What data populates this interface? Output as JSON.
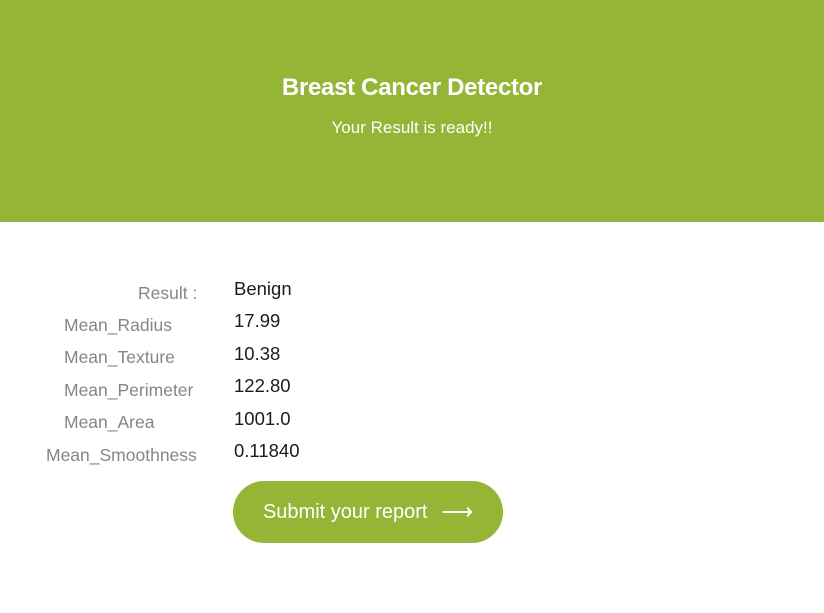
{
  "header": {
    "title": "Breast Cancer Detector",
    "subtitle": "Your Result is ready!!"
  },
  "result": {
    "label": "Result :",
    "value": "Benign"
  },
  "fields": [
    {
      "label": "Mean_Radius",
      "value": "17.99"
    },
    {
      "label": "Mean_Texture",
      "value": "10.38"
    },
    {
      "label": "Mean_Perimeter",
      "value": "122.80"
    },
    {
      "label": "Mean_Area",
      "value": "1001.0"
    },
    {
      "label": "Mean_Smoothness",
      "value": "0.11840"
    }
  ],
  "button": {
    "label": "Submit your report",
    "icon": "arrow-right-icon"
  },
  "colors": {
    "accent": "#94b535"
  }
}
